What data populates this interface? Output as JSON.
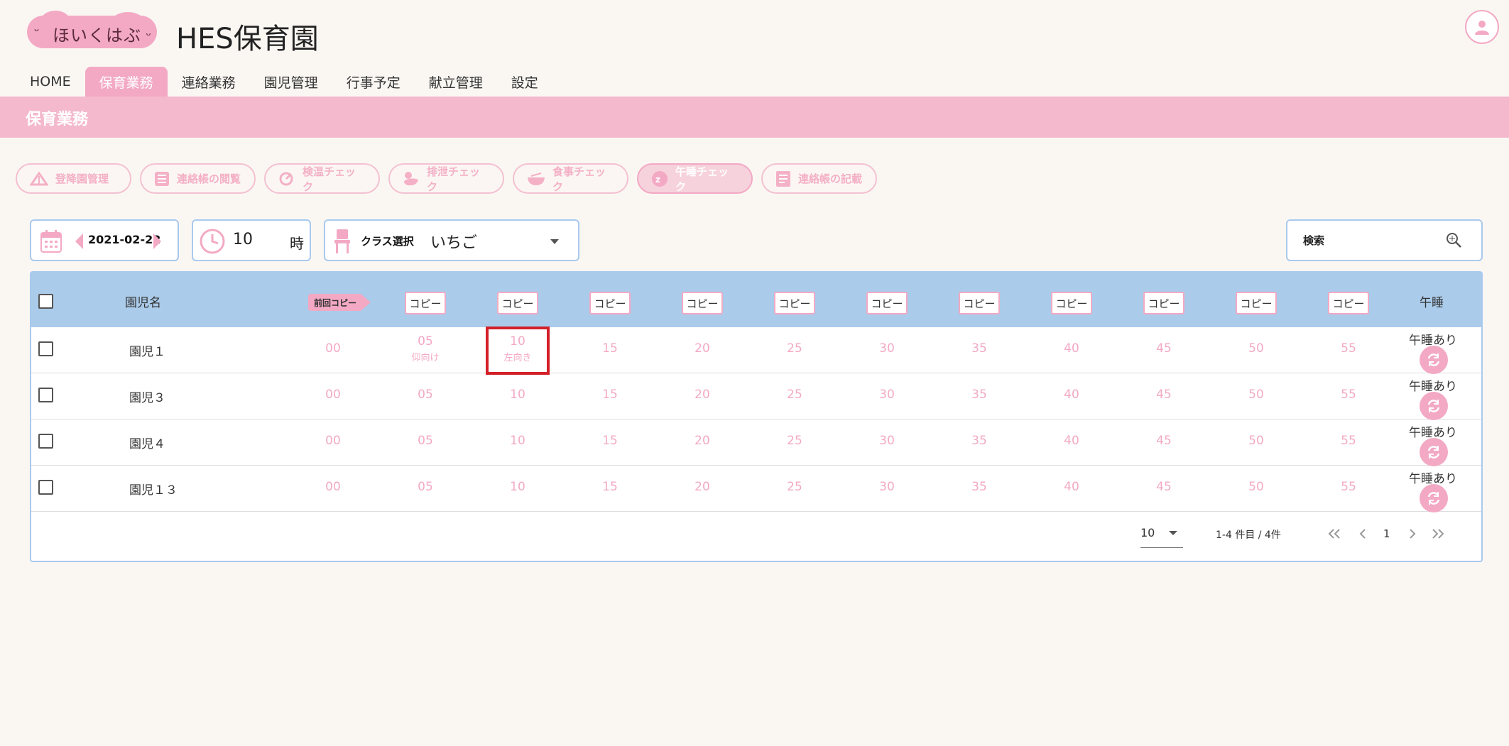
{
  "header": {
    "logo_text": "ほいくはぶ",
    "site_title": "HES保育園"
  },
  "nav": [
    {
      "label": "HOME"
    },
    {
      "label": "保育業務",
      "active": true
    },
    {
      "label": "連絡業務"
    },
    {
      "label": "園児管理"
    },
    {
      "label": "行事予定"
    },
    {
      "label": "献立管理"
    },
    {
      "label": "設定"
    }
  ],
  "section_title": "保育業務",
  "functions": [
    {
      "label": "登降園管理",
      "icon": "attendance-icon"
    },
    {
      "label": "連絡帳の閲覧",
      "icon": "list-icon"
    },
    {
      "label": "検温チェック",
      "icon": "thermometer-icon"
    },
    {
      "label": "排泄チェック",
      "icon": "duck-icon"
    },
    {
      "label": "食事チェック",
      "icon": "bowl-icon"
    },
    {
      "label": "午睡チェック",
      "icon": "nap-icon",
      "active": true
    },
    {
      "label": "連絡帳の記載",
      "icon": "notebook-icon"
    }
  ],
  "filters": {
    "date": "2021-02-22",
    "hour": "10",
    "hour_unit": "時",
    "class_label": "クラス選択",
    "class_value": "いちご",
    "search_placeholder": "検索"
  },
  "table": {
    "col_name": "園児名",
    "prev_copy": "前回コピー",
    "copy_label": "コピー",
    "col_nap": "午睡",
    "minutes": [
      "00",
      "05",
      "10",
      "15",
      "20",
      "25",
      "30",
      "35",
      "40",
      "45",
      "50",
      "55"
    ],
    "rows": [
      {
        "name": "園児１",
        "nap": "午睡あり",
        "notes": {
          "05": "仰向け",
          "10": "左向き"
        }
      },
      {
        "name": "園児３",
        "nap": "午睡あり",
        "notes": {}
      },
      {
        "name": "園児４",
        "nap": "午睡あり",
        "notes": {}
      },
      {
        "name": "園児１３",
        "nap": "午睡あり",
        "notes": {}
      }
    ]
  },
  "pagination": {
    "per_page": "10",
    "range": "1-4 件目 / 4件",
    "current_page": "1"
  },
  "colors": {
    "brand_pink": "#f3a9c4",
    "band_pink": "#f4b9cd",
    "header_blue": "#aacbea",
    "highlight_red": "#d32028"
  }
}
